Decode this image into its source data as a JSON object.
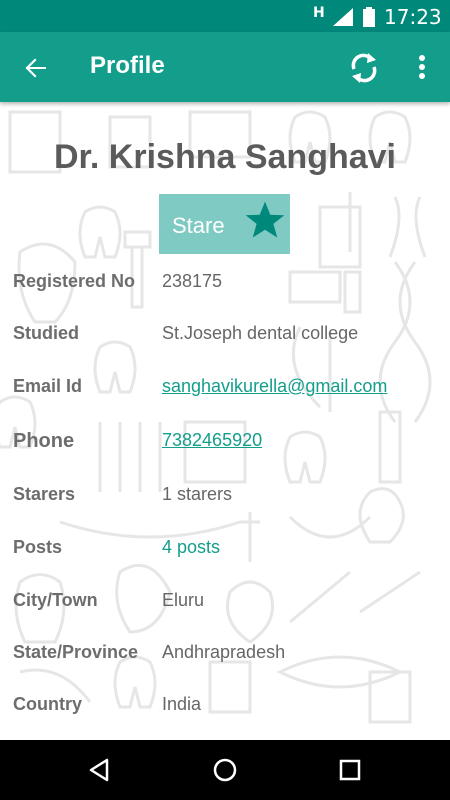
{
  "status_bar": {
    "network": "H",
    "time": "17:23"
  },
  "app_bar": {
    "title": "Profile"
  },
  "profile": {
    "name": "Dr. Krishna Sanghavi",
    "stare_label": "Stare",
    "fields": [
      {
        "label": "Registered No",
        "value": "238175"
      },
      {
        "label": "Studied",
        "value": "St.Joseph dental college"
      },
      {
        "label": "Email Id",
        "value": "sanghavikurella@gmail.com"
      },
      {
        "label": "Phone",
        "value": "7382465920"
      },
      {
        "label": "Starers",
        "value": "1 starers"
      },
      {
        "label": "Posts",
        "value": "4 posts"
      },
      {
        "label": "City/Town",
        "value": "Eluru"
      },
      {
        "label": "State/Province",
        "value": "Andhrapradesh"
      },
      {
        "label": "Country",
        "value": "India"
      }
    ]
  },
  "icons": {
    "back": "arrow-back-icon",
    "refresh": "refresh-icon",
    "more": "more-vert-icon",
    "star": "star-icon",
    "nav_back": "nav-back-icon",
    "nav_home": "nav-home-icon",
    "nav_recents": "nav-recents-icon"
  },
  "colors": {
    "primary": "#139e8b",
    "primary_dark": "#00897b",
    "stare_button": "#80cbc4",
    "label_text": "#6d6d6d",
    "value_text": "#666666"
  }
}
